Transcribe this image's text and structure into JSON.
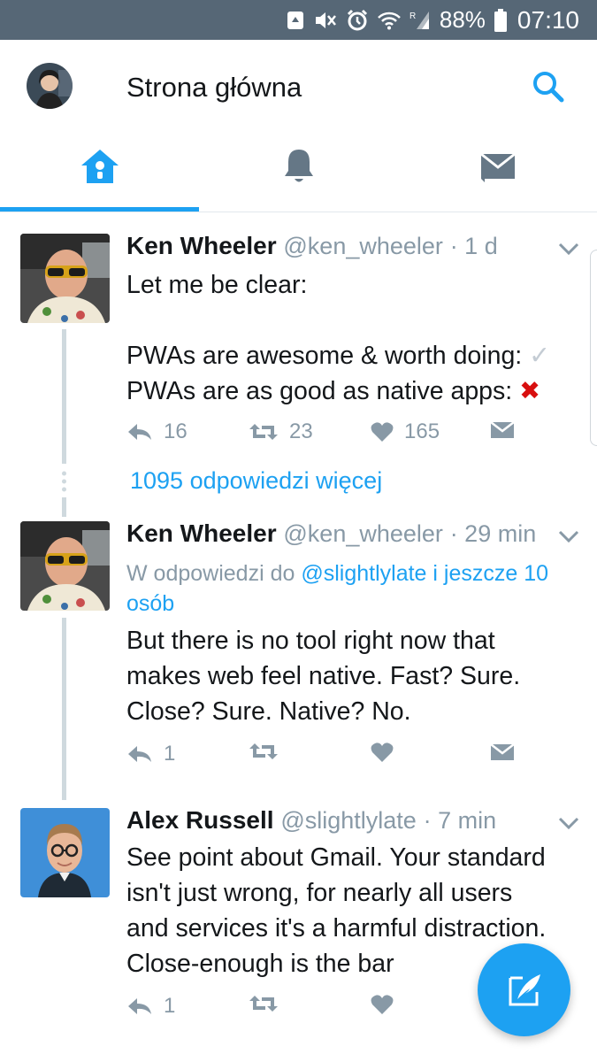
{
  "status_bar": {
    "battery": "88%",
    "time": "07:10",
    "icons": [
      "recycle-notification-icon",
      "mute-icon",
      "alarm-icon",
      "wifi-icon",
      "signal-icon",
      "battery-icon"
    ]
  },
  "app_bar": {
    "title": "Strona główna",
    "icons": [
      "avatar",
      "search-icon"
    ]
  },
  "tabs": [
    {
      "name": "home",
      "icon": "home-icon",
      "active": true
    },
    {
      "name": "notifications",
      "icon": "bell-icon",
      "active": false
    },
    {
      "name": "messages",
      "icon": "envelope-icon",
      "active": false
    }
  ],
  "tweets": [
    {
      "name": "Ken Wheeler",
      "handle": "@ken_wheeler",
      "time": "· 1 d",
      "text_line1": "Let me be clear:",
      "text_line2": "PWAs are awesome & worth doing:",
      "text_line3": "PWAs are as good as native apps:",
      "check_glyph": "✓",
      "cross_glyph": "✖",
      "replies": "16",
      "retweets": "23",
      "likes": "165"
    },
    {
      "name": "Ken Wheeler",
      "handle": "@ken_wheeler",
      "time": "· 29 min",
      "reply_prefix": "W odpowiedzi do",
      "reply_link": "@slightlylate i jeszcze 10",
      "reply_link2": "osób",
      "text_line1": "But there is no tool right now that",
      "text_line2": "makes web feel native. Fast? Sure.",
      "text_line3": "Close? Sure. Native? No.",
      "replies": "1"
    },
    {
      "name": "Alex Russell",
      "handle": "@slightlylate",
      "time": "· 7 min",
      "text_line1": "See point about Gmail. Your standard",
      "text_line2": "isn't just wrong, for nearly all users",
      "text_line3": "and services it's a harmful distraction.",
      "text_line4": "Close-enough is the bar",
      "replies": "1"
    }
  ],
  "more_replies": "1095 odpowiedzi więcej",
  "colors": {
    "accent": "#1da1f2",
    "status_bar": "#566776",
    "muted": "#8899a6",
    "thread_line": "#cfd9de"
  }
}
